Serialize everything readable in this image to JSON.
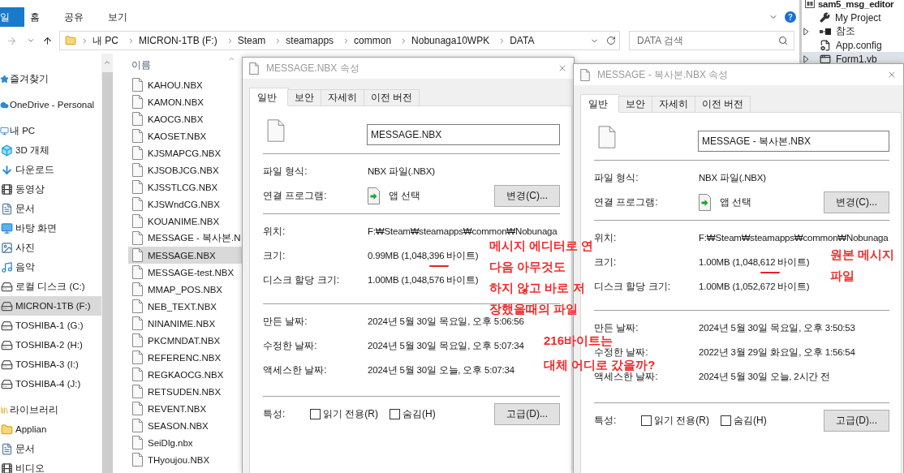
{
  "explorer": {
    "ribbon_tabs": [
      {
        "label": "일",
        "kind": "file"
      },
      {
        "label": "홈",
        "kind": "tab"
      },
      {
        "label": "공유",
        "kind": "tab"
      },
      {
        "label": "보기",
        "kind": "tab"
      }
    ],
    "forward": {
      "disabled": true
    },
    "address": [
      "내 PC",
      "MICRON-1TB (F:)",
      "Steam",
      "steamapps",
      "common",
      "Nobunaga10WPK",
      "DATA"
    ],
    "search": {
      "placeholder": "DATA 검색"
    },
    "nav_tree": [
      {
        "label": "즐겨찾기",
        "kind": "favorites",
        "selected": false
      },
      {
        "label": "OneDrive - Personal",
        "kind": "cloud",
        "selected": false
      },
      {
        "label": "내 PC",
        "kind": "pc",
        "selected": false,
        "children": [
          {
            "label": "3D 개체",
            "kind": "objects",
            "selected": false
          },
          {
            "label": "다운로드",
            "kind": "downloads",
            "selected": false
          },
          {
            "label": "동영상",
            "kind": "videos",
            "selected": false
          },
          {
            "label": "문서",
            "kind": "documents",
            "selected": false
          },
          {
            "label": "바탕 화면",
            "kind": "desktop",
            "selected": false
          },
          {
            "label": "사진",
            "kind": "pictures",
            "selected": false
          },
          {
            "label": "음악",
            "kind": "music",
            "selected": false
          },
          {
            "label": "로컬 디스크 (C:)",
            "kind": "drive",
            "selected": false
          },
          {
            "label": "MICRON-1TB (F:)",
            "kind": "drive",
            "selected": true
          },
          {
            "label": "TOSHIBA-1 (G:)",
            "kind": "drive",
            "selected": false
          },
          {
            "label": "TOSHIBA-2 (H:)",
            "kind": "drive",
            "selected": false
          },
          {
            "label": "TOSHIBA-3 (I:)",
            "kind": "drive",
            "selected": false
          },
          {
            "label": "TOSHIBA-4 (J:)",
            "kind": "drive",
            "selected": false
          }
        ]
      },
      {
        "label": "라이브러리",
        "kind": "libraries",
        "selected": false,
        "children": [
          {
            "label": "Applian",
            "kind": "folder",
            "selected": false
          },
          {
            "label": "문서",
            "kind": "documents",
            "selected": false
          },
          {
            "label": "비디오",
            "kind": "videos",
            "selected": false
          }
        ]
      }
    ],
    "column_header": "이름",
    "files": [
      {
        "name": "KAHOU.NBX",
        "selected": false
      },
      {
        "name": "KAMON.NBX",
        "selected": false
      },
      {
        "name": "KAOCG.NBX",
        "selected": false
      },
      {
        "name": "KAOSET.NBX",
        "selected": false
      },
      {
        "name": "KJSMAPCG.NBX",
        "selected": false
      },
      {
        "name": "KJSOBJCG.NBX",
        "selected": false
      },
      {
        "name": "KJSSTLCG.NBX",
        "selected": false
      },
      {
        "name": "KJSWndCG.NBX",
        "selected": false
      },
      {
        "name": "KOUANIME.NBX",
        "selected": false
      },
      {
        "name": "MESSAGE - 복사본.N",
        "selected": false
      },
      {
        "name": "MESSAGE.NBX",
        "selected": true
      },
      {
        "name": "MESSAGE-test.NBX",
        "selected": false
      },
      {
        "name": "MMAP_POS.NBX",
        "selected": false
      },
      {
        "name": "NEB_TEXT.NBX",
        "selected": false
      },
      {
        "name": "NINANIME.NBX",
        "selected": false
      },
      {
        "name": "PKCMNDAT.NBX",
        "selected": false
      },
      {
        "name": "REFERENC.NBX",
        "selected": false
      },
      {
        "name": "REGKAOCG.NBX",
        "selected": false
      },
      {
        "name": "RETSUDEN.NBX",
        "selected": false
      },
      {
        "name": "REVENT.NBX",
        "selected": false
      },
      {
        "name": "SEASON.NBX",
        "selected": false
      },
      {
        "name": "SeiDlg.nbx",
        "selected": false
      },
      {
        "name": "THyoujou.NBX",
        "selected": false
      }
    ]
  },
  "solution_explorer": {
    "project": "sam5_msg_editor",
    "items": [
      {
        "label": "My Project",
        "kind": "settings",
        "selected": false
      },
      {
        "label": "참조",
        "kind": "references",
        "selected": false,
        "expanded": false
      },
      {
        "label": "App.config",
        "kind": "config",
        "selected": false
      },
      {
        "label": "Form1.vb",
        "kind": "form",
        "selected": true,
        "expanded": false
      }
    ]
  },
  "dialogs": [
    {
      "title": "MESSAGE.NBX 속성",
      "tabs": [
        {
          "label": "일반",
          "selected": true
        },
        {
          "label": "보안",
          "selected": false
        },
        {
          "label": "자세히",
          "selected": false
        },
        {
          "label": "이전 버전",
          "selected": false
        }
      ],
      "file_name": "MESSAGE.NBX",
      "sections": [
        [
          {
            "label": "파일 형식:",
            "value": "NBX 파일(.NBX)",
            "kind": "text",
            "marked": false
          },
          {
            "label": "연결 프로그램:",
            "value": "앱 선택",
            "kind": "app",
            "button": "변경(C)...",
            "marked": false
          }
        ],
        [
          {
            "label": "위치:",
            "value": "F:₩Steam₩steamapps₩common₩Nobunaga",
            "kind": "text",
            "marked": false
          },
          {
            "label": "크기:",
            "value": "0.99MB (1,048,396 바이트)",
            "kind": "text",
            "marked": true
          },
          {
            "label": "디스크 할당 크기:",
            "value": "1.00MB (1,048,576 바이트)",
            "kind": "text",
            "marked": false
          }
        ],
        [
          {
            "label": "만든 날짜:",
            "value": "2024년 5월 30일 목요일, 오후 5:06:56",
            "kind": "text",
            "marked": false
          },
          {
            "label": "수정한 날짜:",
            "value": "2024년 5월 30일 목요일, 오후 5:07:34",
            "kind": "text",
            "marked": false
          },
          {
            "label": "액세스한 날짜:",
            "value": "2024년 5월 30일 오늘, 오후 5:07:34",
            "kind": "text",
            "marked": false
          }
        ]
      ],
      "attributes": {
        "label": "특성:",
        "options": [
          {
            "label": "읽기 전용(R)",
            "checked": false
          },
          {
            "label": "숨김(H)",
            "checked": false
          }
        ],
        "button": "고급(D)..."
      }
    },
    {
      "title": "MESSAGE - 복사본.NBX 속성",
      "tabs": [
        {
          "label": "일반",
          "selected": true
        },
        {
          "label": "보안",
          "selected": false
        },
        {
          "label": "자세히",
          "selected": false
        },
        {
          "label": "이전 버전",
          "selected": false
        }
      ],
      "file_name": "MESSAGE - 복사본.NBX",
      "sections": [
        [
          {
            "label": "파일 형식:",
            "value": "NBX 파일(.NBX)",
            "kind": "text",
            "marked": false
          },
          {
            "label": "연결 프로그램:",
            "value": "앱 선택",
            "kind": "app",
            "button": "변경(C)...",
            "marked": false
          }
        ],
        [
          {
            "label": "위치:",
            "value": "F:₩Steam₩steamapps₩common₩Nobunaga",
            "kind": "text",
            "marked": false
          },
          {
            "label": "크기:",
            "value": "1.00MB (1,048,612 바이트)",
            "kind": "text",
            "marked": true
          },
          {
            "label": "디스크 할당 크기:",
            "value": "1.00MB (1,052,672 바이트)",
            "kind": "text",
            "marked": false
          }
        ],
        [
          {
            "label": "만든 날짜:",
            "value": "2024년 5월 30일 목요일, 오후 3:50:53",
            "kind": "text",
            "marked": false
          },
          {
            "label": "수정한 날짜:",
            "value": "2022년 3월 29일 화요일, 오후 1:56:54",
            "kind": "text",
            "marked": false
          },
          {
            "label": "액세스한 날짜:",
            "value": "2024년 5월 30일 오늘, 2시간 전",
            "kind": "text",
            "marked": false
          }
        ]
      ],
      "attributes": {
        "label": "특성:",
        "options": [
          {
            "label": "읽기 전용(R)",
            "checked": false
          },
          {
            "label": "숨김(H)",
            "checked": false
          }
        ],
        "button": "고급(D)..."
      }
    }
  ],
  "annotations": [
    {
      "lines": [
        "메시지 에디터로 연",
        "다음 아무것도",
        "하지 않고 바로 저",
        "장했을때의 파일"
      ]
    },
    {
      "lines": [
        "216바이트는",
        "대체 어디로 갔을까?"
      ]
    },
    {
      "lines": [
        "원본 메시지",
        "파일"
      ]
    }
  ]
}
